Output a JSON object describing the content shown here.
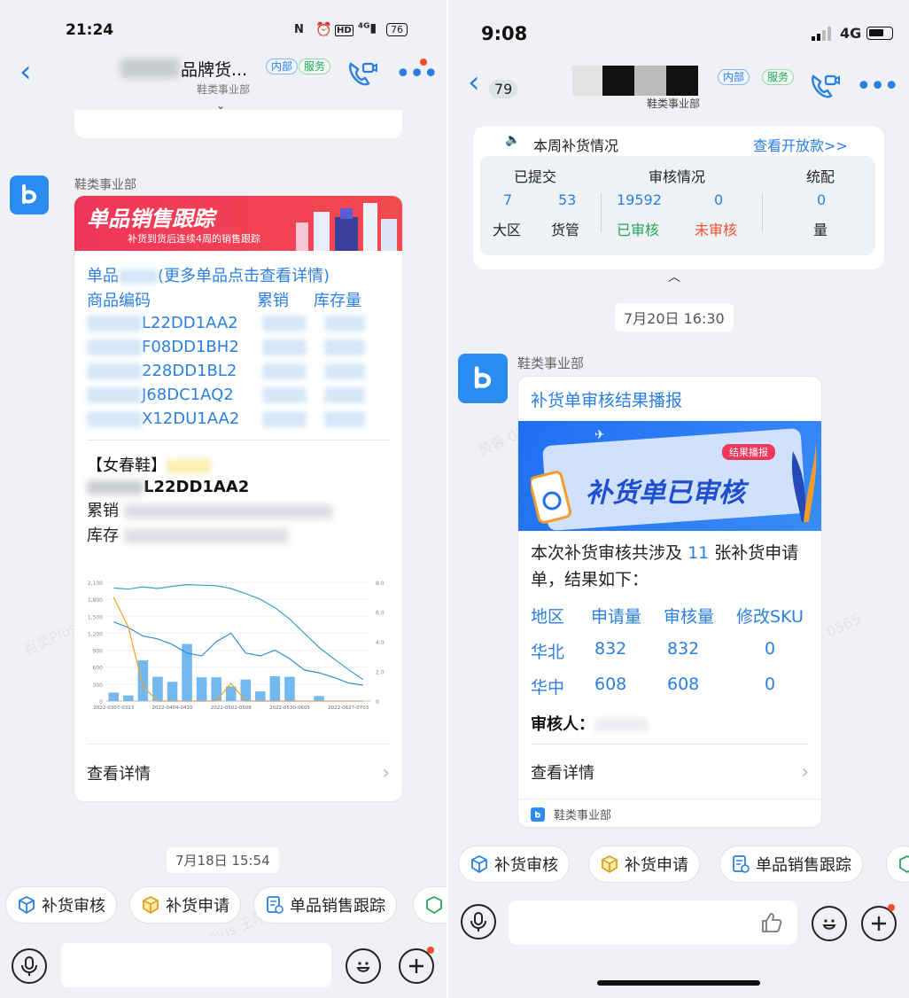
{
  "left": {
    "status_time": "21:24",
    "status_battery": "76",
    "title_suffix": "品牌货...",
    "tag_internal": "内部",
    "tag_service": "服务",
    "subtitle": "鞋类事业部",
    "sender": "鞋类事业部",
    "banner_title": "单品销售跟踪",
    "banner_subtitle": "补货到货后连续4周的销售跟踪",
    "item_link_prefix": "单品",
    "item_link_suffix": "(更多单品点击查看详情)",
    "columns": [
      "商品编码",
      "累销",
      "库存量"
    ],
    "codes": [
      "L22DD1AA2",
      "F08DD1BH2",
      "228DD1BL2",
      "J68DC1AQ2",
      "X12DU1AA2"
    ],
    "product_category": "【女春鞋】",
    "product_code": "L22DD1AA2",
    "label_sales": "累销",
    "label_stock": "库存",
    "view_details": "查看详情",
    "timestamp": "7月18日 15:54",
    "chips": [
      "补货审核",
      "补货申请",
      "单品销售跟踪"
    ]
  },
  "right": {
    "status_time": "9:08",
    "status_network": "4G",
    "unread_count": "79",
    "tag_internal": "内部",
    "tag_service": "服务",
    "subtitle": "鞋类事业部",
    "weekly_title": "本周补货情况",
    "weekly_link": "查看开放款>>",
    "weekly_headers": [
      "已提交",
      "审核情况",
      "统配"
    ],
    "weekly_values": [
      "7",
      "53",
      "19592",
      "0",
      "0"
    ],
    "weekly_labels": [
      "大区",
      "货管",
      "已审核",
      "未审核",
      "量"
    ],
    "timestamp": "7月20日 16:30",
    "sender": "鞋类事业部",
    "card_title": "补货单审核结果播报",
    "banner_badge": "结果播报",
    "banner_text": "补货单已审核",
    "summary_prefix": "本次补货审核共涉及",
    "summary_count": "11",
    "summary_suffix": "张补货申请单，结果如下：",
    "table_headers": [
      "地区",
      "申请量",
      "审核量",
      "修改SKU"
    ],
    "table_rows": [
      {
        "region": "华北",
        "applied": "832",
        "approved": "832",
        "modified": "0"
      },
      {
        "region": "华中",
        "applied": "608",
        "approved": "608",
        "modified": "0"
      }
    ],
    "reviewer_label": "审核人：",
    "view_details": "查看详情",
    "card_footer": "鞋类事业部",
    "chips": [
      "补货审核",
      "补货申请",
      "单品销售跟踪"
    ]
  },
  "colors": {
    "accent": "#2a7fe0",
    "green": "#26a55b",
    "red": "#f0512f",
    "banner_red": "#f0365a"
  },
  "chart_data": {
    "type": "bar",
    "categories": [
      "2022-0307-0313",
      "",
      "",
      "",
      "2022-0404-0410",
      "",
      "",
      "",
      "2022-0502-0508",
      "",
      "",
      "",
      "2022-0530-0605",
      "",
      "",
      "",
      "2022-0627-0703",
      ""
    ],
    "x_tick_labels": [
      "2022-0307-0313",
      "2022-0404-0410",
      "2022-0502-0508",
      "2022-0530-0605",
      "2022-0627-0703"
    ],
    "y_left_ticks": [
      "0",
      "300",
      "600",
      "900",
      "1,200",
      "1,500",
      "1,800",
      "2,100"
    ],
    "y_right_ticks": [
      "0",
      "2.0",
      "4.0",
      "6.0",
      "8.0"
    ],
    "ylim": [
      0,
      2100
    ],
    "y2lim": [
      0,
      8
    ],
    "series": [
      {
        "type": "bar",
        "values": [
          150,
          100,
          720,
          430,
          340,
          1010,
          420,
          420,
          260,
          380,
          170,
          440,
          430,
          0,
          90,
          0,
          0,
          0
        ]
      },
      {
        "type": "line",
        "values": [
          2000,
          1980,
          2020,
          1990,
          2030,
          2060,
          2050,
          2040,
          1990,
          1900,
          1800,
          1650,
          1450,
          1200,
          950,
          750,
          560,
          380
        ]
      },
      {
        "type": "line",
        "values": [
          1400,
          1300,
          1150,
          1100,
          1000,
          850,
          800,
          1050,
          1200,
          850,
          800,
          900,
          750,
          550,
          500,
          420,
          320,
          280
        ]
      },
      {
        "type": "line",
        "axis": "right",
        "values": [
          7.0,
          5.0,
          1.0,
          0.0,
          0.0,
          0.0,
          0.0,
          0.0,
          1.2,
          0.0,
          0.0,
          0.0,
          0.0,
          0.0,
          0.0,
          0.0,
          0.0,
          0.0
        ]
      }
    ]
  }
}
